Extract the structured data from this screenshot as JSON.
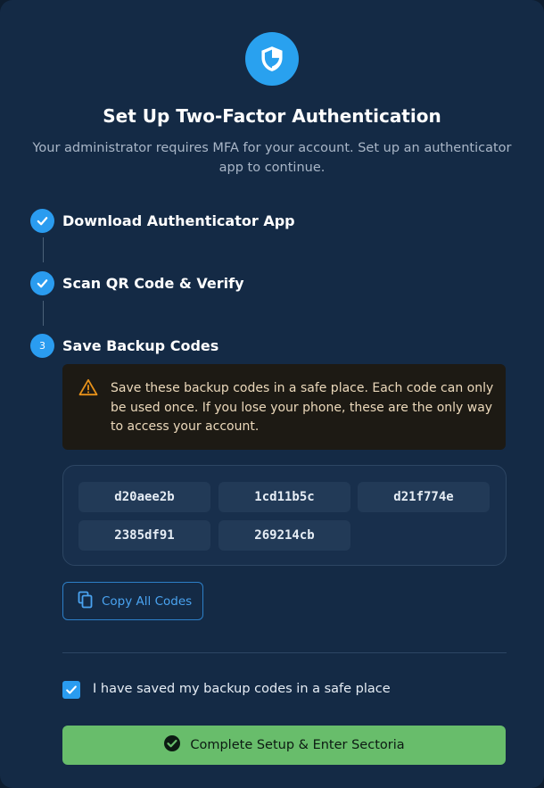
{
  "header": {
    "icon": "shield-icon",
    "title": "Set Up Two-Factor Authentication",
    "subtitle": "Your administrator requires MFA for your account. Set up an authenticator app to continue."
  },
  "steps": [
    {
      "label": "Download Authenticator App",
      "status": "complete",
      "icon": "check-icon"
    },
    {
      "label": "Scan QR Code & Verify",
      "status": "complete",
      "icon": "check-icon"
    },
    {
      "label": "Save Backup Codes",
      "status": "current",
      "number": "3"
    }
  ],
  "warning": {
    "icon": "warning-icon",
    "text": "Save these backup codes in a safe place. Each code can only be used once. If you lose your phone, these are the only way to access your account."
  },
  "backup_codes": [
    "d20aee2b",
    "1cd11b5c",
    "d21f774e",
    "2385df91",
    "269214cb"
  ],
  "copy_button": {
    "label": "Copy All Codes",
    "icon": "copy-icon"
  },
  "confirm": {
    "label": "I have saved my backup codes in a safe place",
    "checked": true
  },
  "submit_button": {
    "label": "Complete Setup & Enter Sectoria",
    "icon": "check-circle-icon"
  },
  "colors": {
    "background": "#142a45",
    "accent": "#2a9cf0",
    "success": "#68bd6b",
    "warning": "#e8921a"
  }
}
